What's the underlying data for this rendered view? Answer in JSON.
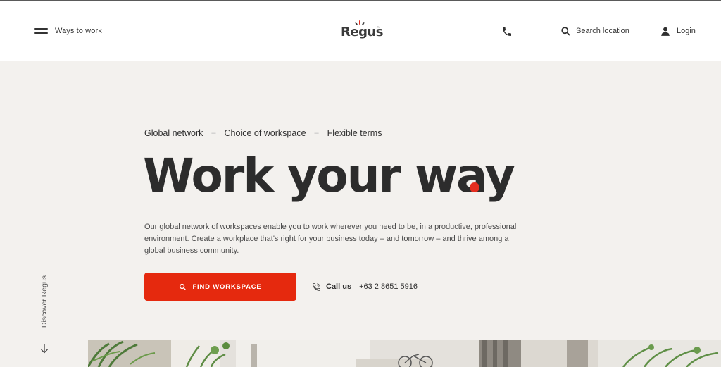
{
  "header": {
    "menu_label": "Ways to work",
    "logo_text": "Regus",
    "logo_tm": "™",
    "search_label": "Search location",
    "login_label": "Login"
  },
  "hero": {
    "features": [
      "Global network",
      "Choice of workspace",
      "Flexible terms"
    ],
    "separator": "–",
    "title": "Work your way",
    "description": "Our global network of workspaces enable you to work wherever you need to be, in a productive, professional environment. Create a workplace that's right for your business today – and tomorrow – and thrive among a global business community.",
    "cta_label": "FIND WORKSPACE",
    "call_label": "Call us",
    "call_number": "+63 2 8651 5916"
  },
  "side": {
    "discover_label": "Discover Regus"
  },
  "colors": {
    "accent": "#e5290e",
    "background": "#f3f1ee",
    "text": "#2b2b2b"
  }
}
